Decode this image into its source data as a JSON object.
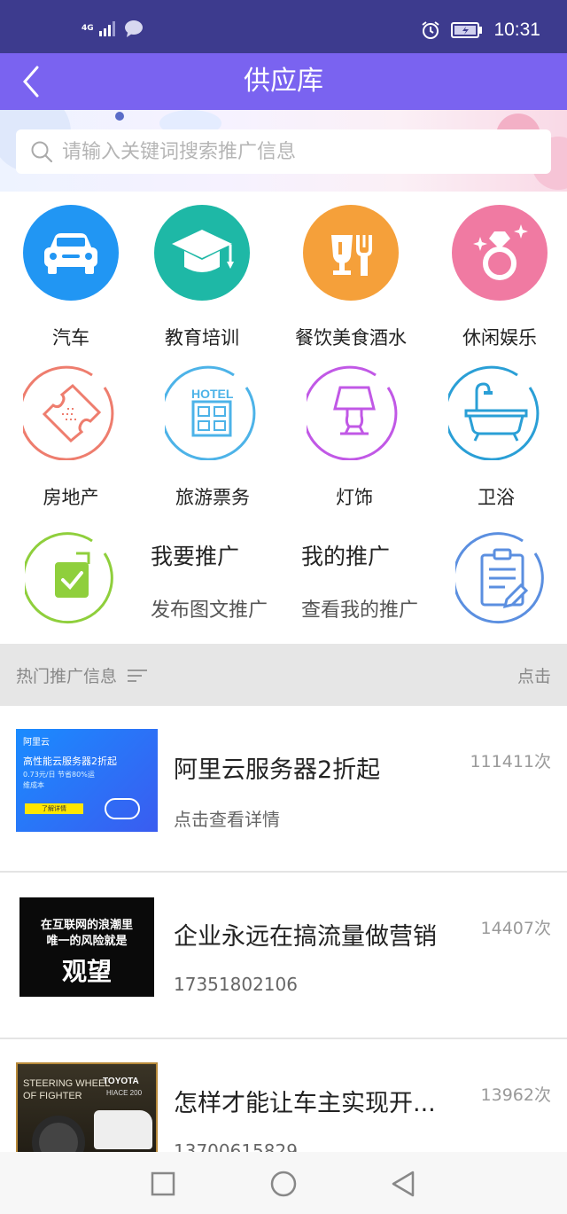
{
  "status_bar": {
    "network": "4G",
    "time": "10:31"
  },
  "header": {
    "title": "供应库"
  },
  "search": {
    "placeholder": "请输入关键词搜索推广信息"
  },
  "categories": [
    {
      "label": "汽车",
      "icon": "car-icon",
      "color": "#2196f3"
    },
    {
      "label": "教育培训",
      "icon": "graduation-cap-icon",
      "color": "#1eb8a6"
    },
    {
      "label": "餐饮美食酒水",
      "icon": "food-drink-icon",
      "color": "#f5a03a"
    },
    {
      "label": "休闲娱乐",
      "icon": "diamond-ring-icon",
      "color": "#f07aa2"
    },
    {
      "label": "房地产",
      "icon": "ticket-icon",
      "color": "#ee7d6e"
    },
    {
      "label": "旅游票务",
      "icon": "hotel-icon",
      "color": "#4db3e8"
    },
    {
      "label": "灯饰",
      "icon": "lamp-icon",
      "color": "#c158e6"
    },
    {
      "label": "卫浴",
      "icon": "bathtub-icon",
      "color": "#2a9fd6"
    }
  ],
  "promote": {
    "publish_title": "我要推广",
    "publish_sub": "发布图文推广",
    "mine_title": "我的推广",
    "mine_sub": "查看我的推广"
  },
  "section": {
    "label": "热门推广信息",
    "sort_label": "点击"
  },
  "list": [
    {
      "title": "阿里云服务器2折起",
      "subtitle": "点击查看详情",
      "count": "111411次",
      "thumb": {
        "brand": "阿里云",
        "headline": "高性能云服务器2折起",
        "detail1": "0.73元/日 节省80%运",
        "detail2": "维成本",
        "button": "了解详情"
      }
    },
    {
      "title": "企业永远在搞流量做营销",
      "subtitle": "17351802106",
      "count": "14407次",
      "thumb": {
        "line1": "在互联网的浪潮里",
        "line2": "唯一的风险就是",
        "big": "观望"
      }
    },
    {
      "title": "怎样才能让车主实现开...",
      "subtitle": "13700615829",
      "count": "13962次",
      "thumb": {
        "line1": "STEERING WHEEL",
        "line2": "OF FIGHTER",
        "brand": "TOYOTA",
        "model": "HIACE 200"
      }
    }
  ]
}
